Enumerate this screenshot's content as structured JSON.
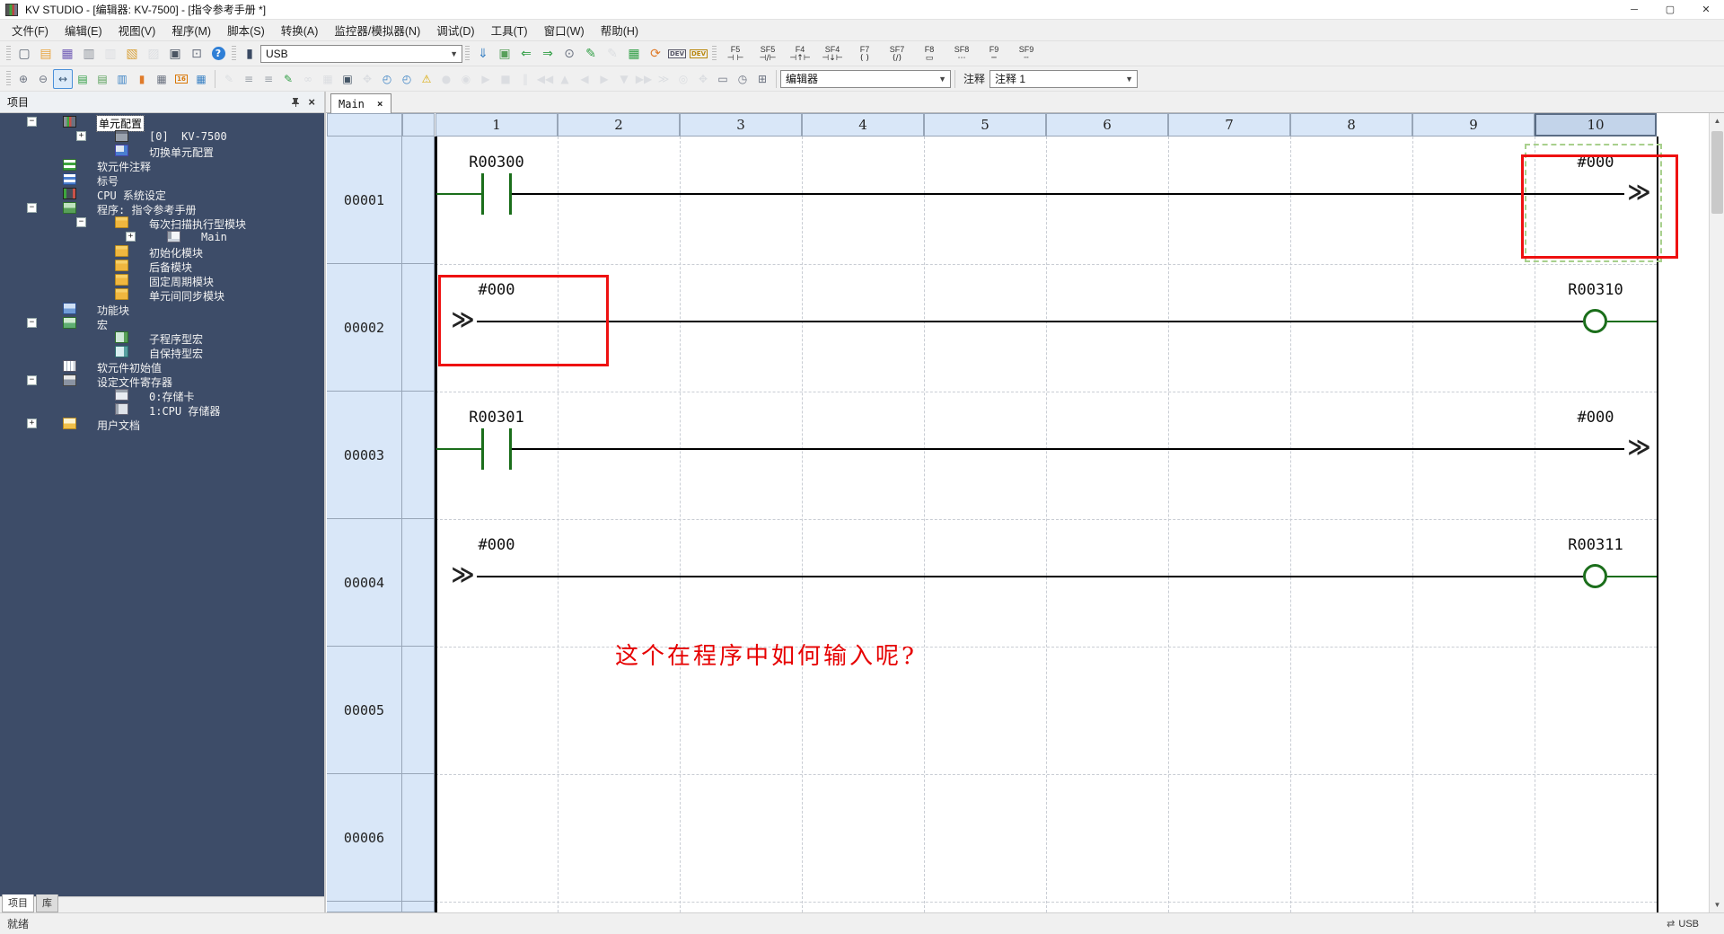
{
  "window": {
    "title": "KV STUDIO - [编辑器: KV-7500] - [指令参考手册 *]",
    "controls": {
      "minimize": "─",
      "maximize": "▢",
      "close": "✕"
    }
  },
  "menu": [
    "文件(F)",
    "编辑(E)",
    "视图(V)",
    "程序(M)",
    "脚本(S)",
    "转换(A)",
    "监控器/模拟器(N)",
    "调试(D)",
    "工具(T)",
    "窗口(W)",
    "帮助(H)"
  ],
  "toolbar1": {
    "file_icons": [
      {
        "n": "new-project-icon",
        "g": "▢",
        "c": "#5a6472"
      },
      {
        "n": "open-project-icon",
        "g": "▤",
        "c": "#e8a33d"
      },
      {
        "n": "save-project-icon",
        "g": "▦",
        "c": "#6f5bb5"
      },
      {
        "n": "save-ladder-icon",
        "g": "▥",
        "c": "#8a9099"
      },
      {
        "n": "save-as-icon",
        "g": "▥",
        "c": "#c3c8cf",
        "d": 1
      },
      {
        "n": "import-file-icon",
        "g": "▧",
        "c": "#d9a23b"
      },
      {
        "n": "export-file-icon",
        "g": "▨",
        "c": "#c3c8cf",
        "d": 1
      },
      {
        "n": "print-icon",
        "g": "▣",
        "c": "#4b5563"
      },
      {
        "n": "print-preview-icon",
        "g": "⊡",
        "c": "#6b7280"
      },
      {
        "n": "help-icon",
        "g": "?",
        "c": "#ffffff",
        "bg": "#2f7fd6"
      }
    ],
    "unit_icon": {
      "n": "communication-unit-icon",
      "g": "▮",
      "c": "#3a4a63"
    },
    "usb_combo": "USB",
    "transfer_icons": [
      {
        "n": "comm-settings-icon",
        "g": "⇓",
        "c": "#3b82c4"
      },
      {
        "n": "plc-transfer-icon",
        "g": "▣",
        "c": "#58a05a"
      },
      {
        "n": "read-from-plc-icon",
        "g": "⇐",
        "c": "#2f9e44"
      },
      {
        "n": "write-to-plc-icon",
        "g": "⇒",
        "c": "#2f9e44"
      },
      {
        "n": "verify-plc-icon",
        "g": "⊙",
        "c": "#6b7280"
      },
      {
        "n": "online-edit-start-icon",
        "g": "✎",
        "c": "#2f9e44"
      },
      {
        "n": "online-edit-end-icon",
        "g": "✎",
        "c": "#c3c8cf",
        "d": 1
      },
      {
        "n": "monitor-table-icon",
        "g": "▦",
        "c": "#2f9e44"
      },
      {
        "n": "simulator-icon",
        "g": "⟳",
        "c": "#e07b2a"
      },
      {
        "n": "dev-monitor-icon",
        "g": "DEV",
        "c": "#555566",
        "t": 1
      },
      {
        "n": "dev-window-icon",
        "g": "DEV",
        "c": "#b8860b",
        "t": 1
      }
    ],
    "fkeys": [
      {
        "label": "F5",
        "glyph": "⊣ ⊢"
      },
      {
        "label": "SF5",
        "glyph": "⊣∕⊢"
      },
      {
        "label": "F4",
        "glyph": "⊣↑⊢"
      },
      {
        "label": "SF4",
        "glyph": "⊣↓⊢"
      },
      {
        "label": "F7",
        "glyph": "( )"
      },
      {
        "label": "SF7",
        "glyph": "(∕)"
      },
      {
        "label": "F8",
        "glyph": "▭"
      },
      {
        "label": "SF8",
        "glyph": "⋯"
      },
      {
        "label": "F9",
        "glyph": "─"
      },
      {
        "label": "SF9",
        "glyph": "┄"
      }
    ]
  },
  "toolbar2": {
    "icons": [
      {
        "n": "zoom-in-icon",
        "g": "⊕",
        "c": "#6b7280"
      },
      {
        "n": "zoom-out-icon",
        "g": "⊖",
        "c": "#6b7280"
      },
      {
        "n": "fit-width-icon",
        "g": "↔",
        "c": "#3a5a7a",
        "s": 1
      },
      {
        "n": "ladder-window-icon",
        "g": "▤",
        "c": "#2f9e44"
      },
      {
        "n": "split-window-top-icon",
        "g": "▤",
        "c": "#58a05a"
      },
      {
        "n": "split-window-bottom-icon",
        "g": "▥",
        "c": "#3b82c4"
      },
      {
        "n": "instruction-reference-icon",
        "g": "▮",
        "c": "#e07b2a"
      },
      {
        "n": "device-usage-list-icon",
        "g": "▦",
        "c": "#6b7280"
      },
      {
        "n": "device-monitor-16-icon",
        "g": "16",
        "c": "#d97706",
        "t": 1
      },
      {
        "n": "batch-monitor-icon",
        "g": "▦",
        "c": "#3b82c4"
      },
      {
        "sep": 1
      },
      {
        "n": "stamp-icon",
        "g": "✎",
        "c": "#c3c8cf",
        "d": 1
      },
      {
        "n": "watch-window-1-icon",
        "g": "≡",
        "c": "#9aa0a8"
      },
      {
        "n": "watch-window-2-icon",
        "g": "≡",
        "c": "#9aa0a8"
      },
      {
        "n": "online-edit-pen-icon",
        "g": "✎",
        "c": "#2f9e44"
      },
      {
        "n": "view-only-icon",
        "g": "∞",
        "c": "#c3c8cf",
        "d": 1
      },
      {
        "n": "ladder-block-icon",
        "g": "▦",
        "c": "#c3c8cf",
        "d": 1
      },
      {
        "n": "plc-write-pen-icon",
        "g": "▣",
        "c": "#445566"
      },
      {
        "n": "drag-hand-icon",
        "g": "✥",
        "c": "#c3c8cf",
        "d": 1
      },
      {
        "n": "stopwatch-set-icon",
        "g": "◴",
        "c": "#3b82c4"
      },
      {
        "n": "stopwatch-add-icon",
        "g": "◴",
        "c": "#3b82c4"
      },
      {
        "n": "error-monitor-icon",
        "g": "⚠",
        "c": "#d9a800"
      },
      {
        "n": "record-icon",
        "g": "●",
        "c": "#c3c8cf",
        "d": 1
      },
      {
        "n": "record-pause-icon",
        "g": "◉",
        "c": "#c3c8cf",
        "d": 1
      },
      {
        "n": "play-icon",
        "g": "▶",
        "c": "#c3c8cf",
        "d": 1
      },
      {
        "n": "stop-icon",
        "g": "■",
        "c": "#c3c8cf",
        "d": 1
      },
      {
        "n": "pause-icon",
        "g": "‖",
        "c": "#c3c8cf",
        "d": 1
      },
      {
        "n": "skip-start-icon",
        "g": "◀◀",
        "c": "#c3c8cf",
        "d": 1
      },
      {
        "n": "step-up-icon",
        "g": "▲",
        "c": "#c3c8cf",
        "d": 1
      },
      {
        "n": "step-back-icon",
        "g": "◀",
        "c": "#c3c8cf",
        "d": 1
      },
      {
        "n": "step-forward-icon",
        "g": "▶",
        "c": "#c3c8cf",
        "d": 1
      },
      {
        "n": "step-down-icon",
        "g": "▼",
        "c": "#c3c8cf",
        "d": 1
      },
      {
        "n": "skip-end-icon",
        "g": "▶▶",
        "c": "#c3c8cf",
        "d": 1
      },
      {
        "n": "continue-icon",
        "g": "≫",
        "c": "#c3c8cf",
        "d": 1
      },
      {
        "n": "scan-stop-icon",
        "g": "◎",
        "c": "#c3c8cf",
        "d": 1
      },
      {
        "n": "pause-hand-icon",
        "g": "✥",
        "c": "#c3c8cf",
        "d": 1
      },
      {
        "n": "monitor-screen-icon",
        "g": "▭",
        "c": "#6b7280"
      },
      {
        "n": "timer-watch-icon",
        "g": "◷",
        "c": "#6b7280"
      },
      {
        "n": "clock-1200-icon",
        "g": "⊞",
        "c": "#6b7280"
      }
    ],
    "editor_combo": "编辑器",
    "comment_label": "注释",
    "comment_combo": "注释 1"
  },
  "sidebar": {
    "header_title": "项目",
    "tree": [
      {
        "label": "单元配置",
        "depth": 0,
        "icon": "i-unitcfg",
        "exp": "minus",
        "sel": true
      },
      {
        "label": "[0]  KV-7500",
        "depth": 1,
        "icon": "i-unit",
        "exp": "plus"
      },
      {
        "label": "切换单元配置",
        "depth": 1,
        "icon": "i-switch",
        "exp": "none"
      },
      {
        "label": "软元件注释",
        "depth": 0,
        "icon": "i-tgreen",
        "exp": "none"
      },
      {
        "label": "标号",
        "depth": 0,
        "icon": "i-tblue",
        "exp": "none"
      },
      {
        "label": "CPU 系统设定",
        "depth": 0,
        "icon": "i-cpu",
        "exp": "none"
      },
      {
        "label": "程序: 指令参考手册",
        "depth": 0,
        "icon": "i-prog",
        "exp": "minus"
      },
      {
        "label": "每次扫描执行型模块",
        "depth": 1,
        "icon": "i-folder",
        "exp": "minus"
      },
      {
        "label": "Main",
        "depth": 2,
        "icon": "i-ladder",
        "exp": "plus"
      },
      {
        "label": "初始化模块",
        "depth": 1,
        "icon": "i-folder",
        "exp": "none"
      },
      {
        "label": "后备模块",
        "depth": 1,
        "icon": "i-folder",
        "exp": "none"
      },
      {
        "label": "固定周期模块",
        "depth": 1,
        "icon": "i-folder",
        "exp": "none"
      },
      {
        "label": "单元间同步模块",
        "depth": 1,
        "icon": "i-folder",
        "exp": "none"
      },
      {
        "label": "功能块",
        "depth": 0,
        "icon": "i-fb",
        "exp": "none"
      },
      {
        "label": "宏",
        "depth": 0,
        "icon": "i-macro",
        "exp": "minus"
      },
      {
        "label": "子程序型宏",
        "depth": 1,
        "icon": "i-msub",
        "exp": "none"
      },
      {
        "label": "自保持型宏",
        "depth": 1,
        "icon": "i-mhold",
        "exp": "none"
      },
      {
        "label": "软元件初始值",
        "depth": 0,
        "icon": "i-init",
        "exp": "none"
      },
      {
        "label": "设定文件寄存器",
        "depth": 0,
        "icon": "i-filereg",
        "exp": "minus"
      },
      {
        "label": "0:存储卡",
        "depth": 1,
        "icon": "i-card",
        "exp": "none"
      },
      {
        "label": "1:CPU 存储器",
        "depth": 1,
        "icon": "i-mem",
        "exp": "none"
      },
      {
        "label": "用户文档",
        "depth": 0,
        "icon": "i-doc",
        "exp": "plus"
      }
    ],
    "tabs": [
      {
        "label": "项目",
        "active": true
      },
      {
        "label": "库",
        "active": false
      }
    ]
  },
  "ladder": {
    "tab": "Main",
    "columns": [
      "1",
      "2",
      "3",
      "4",
      "5",
      "6",
      "7",
      "8",
      "9",
      "10"
    ],
    "selected_column": "10",
    "rungs": [
      {
        "number": "00001",
        "type": "contact_to_wrap",
        "contact": "R00300",
        "wrap": "#000",
        "wrap_selected": true,
        "red_box": "wrap"
      },
      {
        "number": "00002",
        "type": "wrap_to_coil",
        "wrap": "#000",
        "coil": "R00310",
        "red_box": "wrap"
      },
      {
        "number": "00003",
        "type": "contact_to_wrap",
        "contact": "R00301",
        "wrap": "#000"
      },
      {
        "number": "00004",
        "type": "wrap_to_coil",
        "wrap": "#000",
        "coil": "R00311"
      },
      {
        "number": "00005",
        "type": "empty",
        "annotation": "这个在程序中如何输入呢?"
      },
      {
        "number": "00006",
        "type": "empty"
      }
    ]
  },
  "status": {
    "left": "就绪",
    "right": "USB"
  }
}
